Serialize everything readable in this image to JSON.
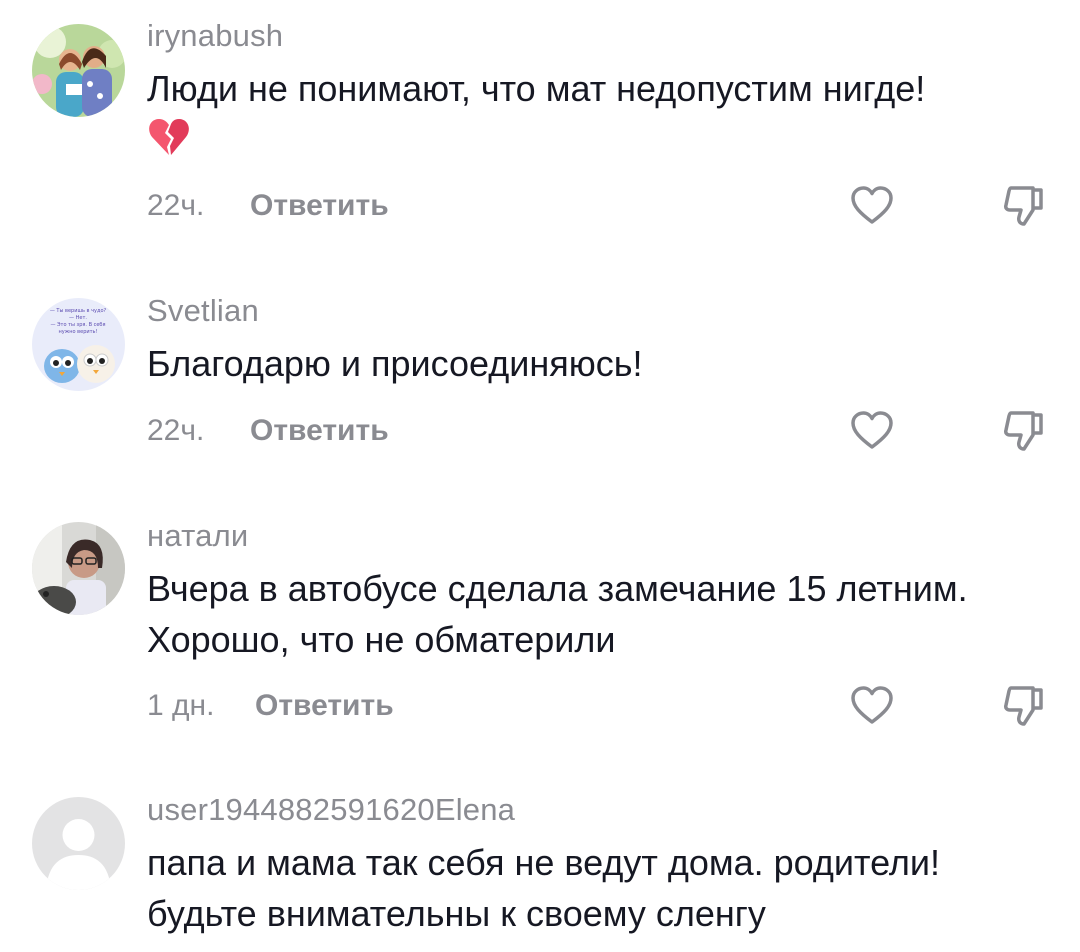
{
  "comments": [
    {
      "username": "irynabush",
      "text_lines": [
        "Люди не понимают, что мат недопустим нигде!"
      ],
      "emoji": "broken-heart",
      "time": "22ч.",
      "reply_label": "Ответить"
    },
    {
      "username": "Svetlian",
      "text_lines": [
        "Благодарю и присоединяюсь!"
      ],
      "avatar_text": [
        "— Ты веришь в чудо?",
        "— Нет.",
        "— Это ты зря. В себя",
        "нужно верить!"
      ],
      "time": "22ч.",
      "reply_label": "Ответить"
    },
    {
      "username": "натали",
      "text_lines": [
        "Вчера в автобусе сделала замечание 15 летним.",
        "Хорошо, что не обматерили"
      ],
      "time": "1 дн.",
      "reply_label": "Ответить"
    },
    {
      "username": "user1944882591620Elena",
      "text_lines": [
        "папа и мама так себя не ведут дома. родители!",
        "будьте внимательны к своему сленгу"
      ]
    }
  ],
  "colors": {
    "text": "#161823",
    "secondary": "#8a8b91",
    "background": "#ffffff",
    "broken_heart": "#f4566e"
  },
  "icons": {
    "like": "heart-outline-icon",
    "dislike": "thumbs-down-outline-icon",
    "emoji": "broken-heart-icon"
  }
}
